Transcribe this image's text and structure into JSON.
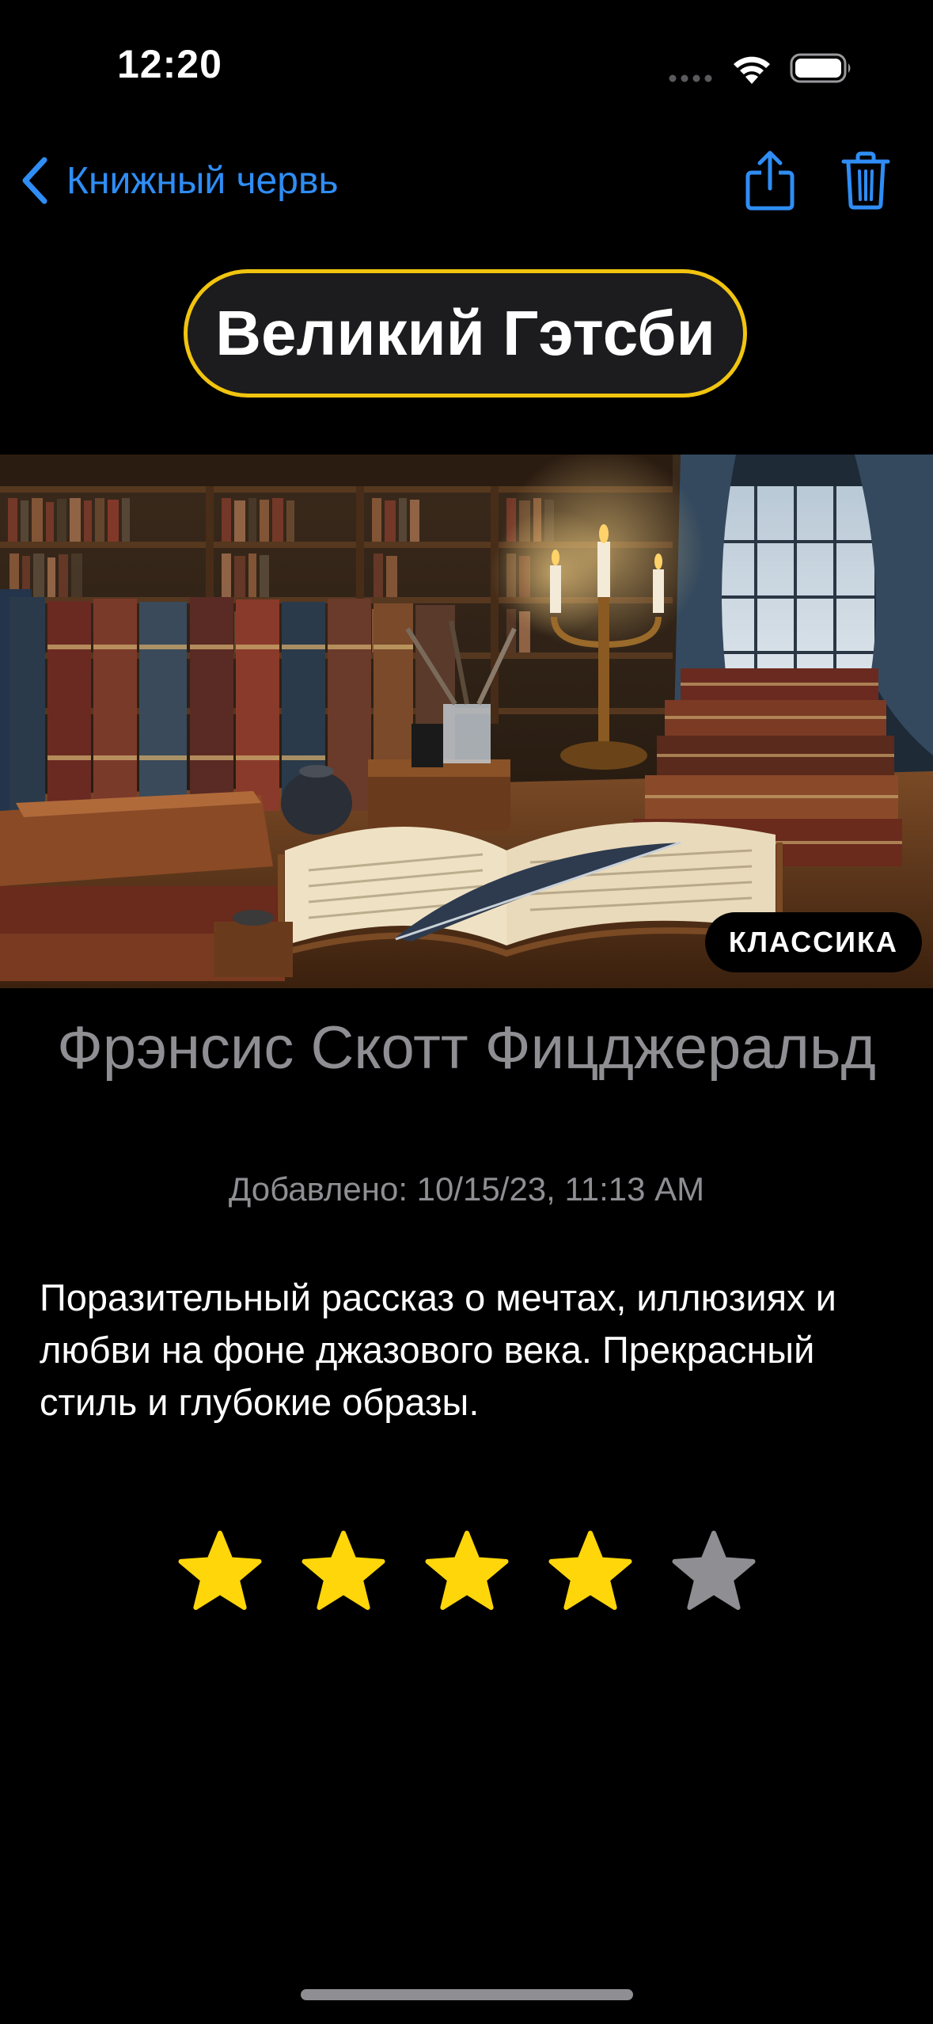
{
  "status_bar": {
    "time": "12:20",
    "icons": [
      "cellular-dots-icon",
      "wifi-icon",
      "battery-icon"
    ]
  },
  "nav": {
    "back_label": "Книжный червь",
    "icons": [
      "chevron-left-icon",
      "share-icon",
      "trash-icon"
    ],
    "accent_color": "#2f8df5"
  },
  "book": {
    "title": "Великий Гэтсби",
    "genre": "КЛАССИКА",
    "author": "Фрэнсис Скотт Фицджеральд",
    "added": "Добавлено: 10/15/23, 11:13 AM",
    "description": "Поразительный рассказ о мечтах, иллюзиях и любви на фоне джазового века. Прекрасный стиль и глубокие образы.",
    "rating": 4,
    "rating_max": 5
  },
  "colors": {
    "title_border": "#f1c40f",
    "star_filled": "#ffd60a",
    "star_empty": "#8e8e93"
  }
}
